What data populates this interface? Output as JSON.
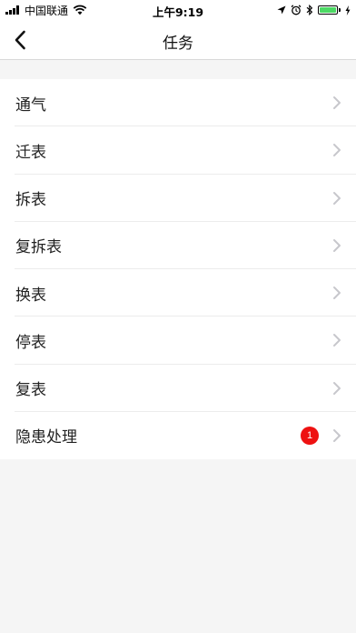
{
  "status_bar": {
    "carrier": "中国联通",
    "time": "上午9:19",
    "battery_color": "#4cd964",
    "icons": [
      "signal-icon",
      "wifi-icon",
      "location-icon",
      "alarm-icon",
      "bluetooth-icon",
      "battery-icon",
      "charging-icon"
    ]
  },
  "nav": {
    "title": "任务",
    "back_icon": "chevron-left-icon"
  },
  "tasks": [
    {
      "label": "通气"
    },
    {
      "label": "迁表"
    },
    {
      "label": "拆表"
    },
    {
      "label": "复拆表"
    },
    {
      "label": "换表"
    },
    {
      "label": "停表"
    },
    {
      "label": "复表"
    },
    {
      "label": "隐患处理",
      "badge": "1"
    }
  ],
  "colors": {
    "badge": "#ee1111",
    "background": "#f5f5f5",
    "chevron": "#c7c7cc"
  }
}
